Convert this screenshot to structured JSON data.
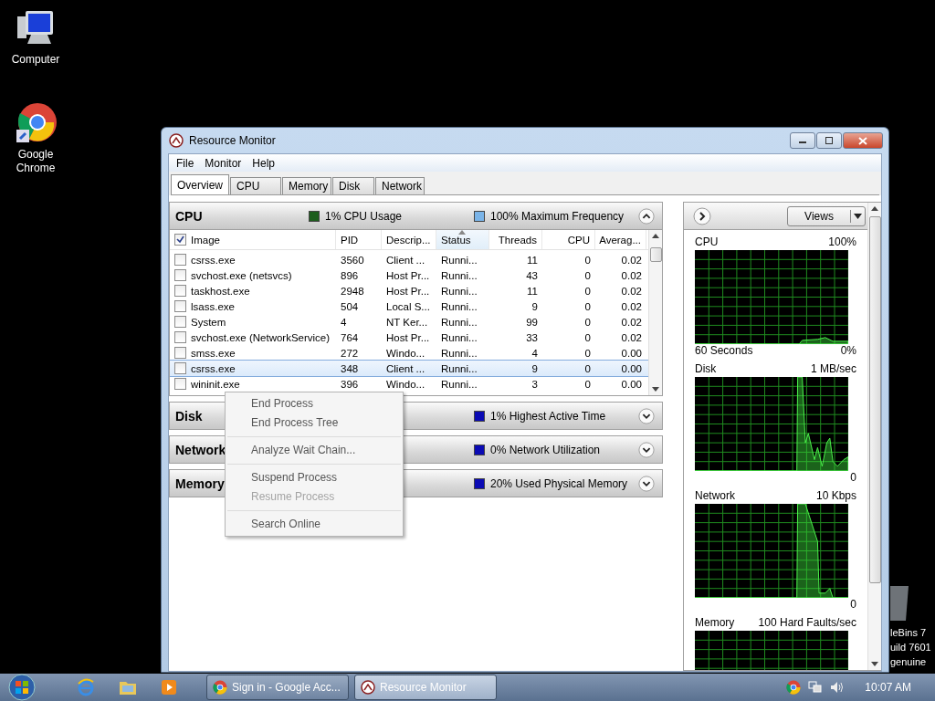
{
  "desktop_icons": [
    {
      "kind": "computer",
      "label": "Computer"
    },
    {
      "kind": "chrome",
      "label": "Google Chrome"
    }
  ],
  "desktop_notice": [
    "leBins 7",
    "uild 7601",
    "genuine"
  ],
  "window": {
    "title": "Resource Monitor",
    "menu": [
      "File",
      "Monitor",
      "Help"
    ],
    "tabs": [
      {
        "label": "Overview",
        "selected": true
      },
      {
        "label": "CPU",
        "selected": false
      },
      {
        "label": "Memory",
        "selected": false
      },
      {
        "label": "Disk",
        "selected": false
      },
      {
        "label": "Network",
        "selected": false
      }
    ],
    "cpu_section": {
      "title": "CPU",
      "expanded": true,
      "legend": [
        {
          "text": "1% CPU Usage",
          "color": "#1d5e1d"
        },
        {
          "text": "100% Maximum Frequency",
          "color": "#7ab4e8"
        }
      ],
      "columns": [
        {
          "label": "Image",
          "sorted": false
        },
        {
          "label": "PID",
          "sorted": false
        },
        {
          "label": "Descrip...",
          "sorted": false
        },
        {
          "label": "Status",
          "sorted": true
        },
        {
          "label": "Threads",
          "sorted": false
        },
        {
          "label": "CPU",
          "sorted": false
        },
        {
          "label": "Averag...",
          "sorted": false
        }
      ],
      "all_checked": true,
      "rows": [
        {
          "image": "csrss.exe",
          "pid": "3560",
          "description": "Client ...",
          "status": "Runni...",
          "threads": "11",
          "cpu": "0",
          "average": "0.02",
          "checked": false,
          "selected": false
        },
        {
          "image": "svchost.exe (netsvcs)",
          "pid": "896",
          "description": "Host Pr...",
          "status": "Runni...",
          "threads": "43",
          "cpu": "0",
          "average": "0.02",
          "checked": false,
          "selected": false
        },
        {
          "image": "taskhost.exe",
          "pid": "2948",
          "description": "Host Pr...",
          "status": "Runni...",
          "threads": "11",
          "cpu": "0",
          "average": "0.02",
          "checked": false,
          "selected": false
        },
        {
          "image": "lsass.exe",
          "pid": "504",
          "description": "Local S...",
          "status": "Runni...",
          "threads": "9",
          "cpu": "0",
          "average": "0.02",
          "checked": false,
          "selected": false
        },
        {
          "image": "System",
          "pid": "4",
          "description": "NT Ker...",
          "status": "Runni...",
          "threads": "99",
          "cpu": "0",
          "average": "0.02",
          "checked": false,
          "selected": false
        },
        {
          "image": "svchost.exe (NetworkService)",
          "pid": "764",
          "description": "Host Pr...",
          "status": "Runni...",
          "threads": "33",
          "cpu": "0",
          "average": "0.02",
          "checked": false,
          "selected": false
        },
        {
          "image": "smss.exe",
          "pid": "272",
          "description": "Windo...",
          "status": "Runni...",
          "threads": "4",
          "cpu": "0",
          "average": "0.00",
          "checked": false,
          "selected": false
        },
        {
          "image": "csrss.exe",
          "pid": "348",
          "description": "Client ...",
          "status": "Runni...",
          "threads": "9",
          "cpu": "0",
          "average": "0.00",
          "checked": false,
          "selected": true
        },
        {
          "image": "wininit.exe",
          "pid": "396",
          "description": "Windo...",
          "status": "Runni...",
          "threads": "3",
          "cpu": "0",
          "average": "0.00",
          "checked": false,
          "selected": false
        }
      ]
    },
    "sections": [
      {
        "title": "Disk",
        "expanded": false,
        "legend": [
          {
            "text": "1% Highest Active Time",
            "color": "#0a0ab4"
          }
        ]
      },
      {
        "title": "Network",
        "expanded": false,
        "legend": [
          {
            "text": "0% Network Utilization",
            "color": "#0a0ab4"
          }
        ]
      },
      {
        "title": "Memory",
        "expanded": false,
        "legend": [
          {
            "text": "20% Used Physical Memory",
            "color": "#0a0ab4"
          }
        ]
      }
    ],
    "views_button": "Views",
    "graphs": [
      {
        "title": "CPU",
        "max": "100%",
        "footer_left": "60 Seconds",
        "min": "0%"
      },
      {
        "title": "Disk",
        "max": "1 MB/sec",
        "min": "0"
      },
      {
        "title": "Network",
        "max": "10 Kbps",
        "min": "0"
      },
      {
        "title": "Memory",
        "max": "100 Hard Faults/sec"
      }
    ]
  },
  "context_menu": [
    {
      "label": "End Process",
      "disabled": false,
      "separator_after": false
    },
    {
      "label": "End Process Tree",
      "disabled": false,
      "separator_after": true
    },
    {
      "label": "Analyze Wait Chain...",
      "disabled": false,
      "separator_after": true
    },
    {
      "label": "Suspend Process",
      "disabled": false,
      "separator_after": false
    },
    {
      "label": "Resume Process",
      "disabled": true,
      "separator_after": true
    },
    {
      "label": "Search Online",
      "disabled": false,
      "separator_after": false
    }
  ],
  "taskbar": {
    "quick_launch": [
      {
        "kind": "ie"
      },
      {
        "kind": "folder"
      },
      {
        "kind": "media"
      }
    ],
    "tasks": [
      {
        "kind": "chrome",
        "label": "Sign in - Google Acc...",
        "selected": false
      },
      {
        "kind": "resmon",
        "label": "Resource Monitor",
        "selected": true
      }
    ],
    "clock": "10:07 AM"
  }
}
